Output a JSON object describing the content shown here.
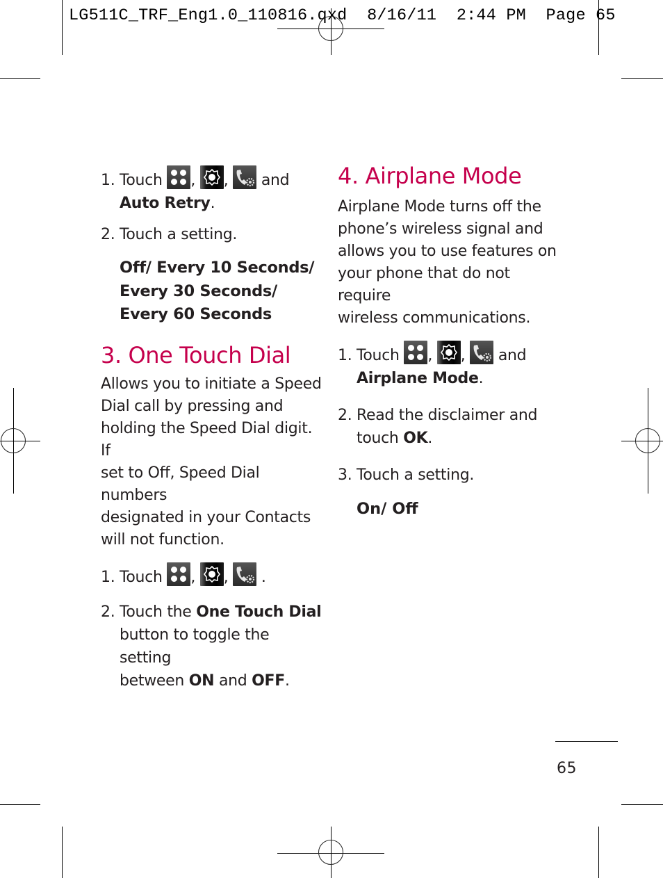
{
  "slug": {
    "filename": "LG511C_TRF_Eng1.0_110816.qxd",
    "date": "8/16/11",
    "time": "2:44 PM",
    "page_label": "Page 65"
  },
  "colors": {
    "heading": "#c5004c",
    "text": "#231f20"
  },
  "icons": [
    "menu-grid-icon",
    "settings-gear-icon",
    "call-settings-icon"
  ],
  "left_column": {
    "auto_retry_steps": [
      {
        "num": "1.",
        "pre": "Touch ",
        "sep1": ", ",
        "sep2": ", ",
        "post": " and",
        "bold": "Auto Retry",
        "end": "."
      },
      {
        "num": "2.",
        "text": "Touch a setting."
      }
    ],
    "auto_retry_options": [
      "Off/ Every 10 Seconds/",
      "Every 30 Seconds/",
      "Every 60 Seconds"
    ],
    "one_touch_dial": {
      "heading": "3. One Touch Dial",
      "description_lines": [
        "Allows you to initiate a Speed",
        "Dial call by pressing and",
        "holding the Speed Dial digit. If",
        "set to Off, Speed Dial numbers",
        "designated in your Contacts",
        "will not function."
      ],
      "step1": {
        "num": "1.",
        "pre": "Touch ",
        "sep1": ", ",
        "sep2": ", ",
        "post": " ."
      },
      "step2": {
        "num": "2.",
        "pre": "Touch the ",
        "bold": "One Touch Dial",
        "line2": "button to toggle the setting",
        "line3_pre": "between ",
        "on": "ON",
        "and": " and ",
        "off": "OFF",
        "end": "."
      }
    }
  },
  "right_column": {
    "airplane_mode": {
      "heading": "4. Airplane Mode",
      "description_lines": [
        "Airplane Mode turns off the",
        "phone’s wireless signal and",
        "allows you to use features on",
        "your phone that do not require",
        "wireless communications."
      ],
      "step1": {
        "num": "1.",
        "pre": "Touch ",
        "sep1": ", ",
        "sep2": ", ",
        "post": " and",
        "bold": "Airplane Mode",
        "end": "."
      },
      "step2": {
        "num": "2.",
        "line1": "Read the disclaimer and",
        "pre": "touch ",
        "bold": "OK",
        "end": "."
      },
      "step3": {
        "num": "3.",
        "text": "Touch a setting."
      },
      "options": "On/ Off"
    }
  },
  "footer": {
    "page_number": "65"
  }
}
